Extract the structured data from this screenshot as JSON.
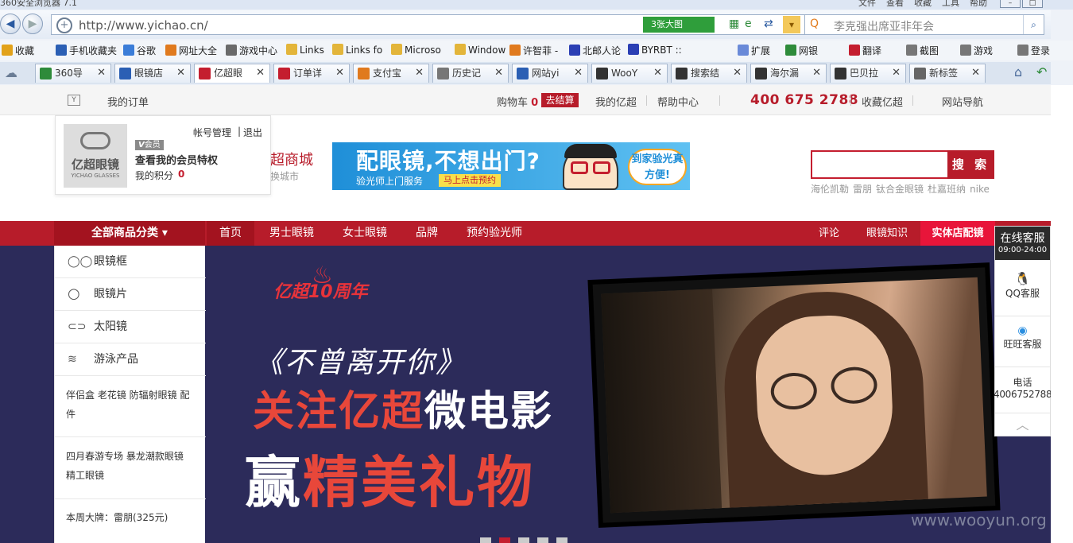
{
  "browser": {
    "title": "360安全浏览器 7.1",
    "menu": [
      "文件",
      "查看",
      "收藏",
      "工具",
      "帮助"
    ],
    "url": "http://www.yichao.cn/",
    "big_image_btn": "3张大图",
    "search_placeholder": "李克强出席亚非年会",
    "favorites": [
      {
        "label": "收藏",
        "icon": "star-icon"
      },
      {
        "label": "手机收藏夹",
        "icon": "phone-icon"
      },
      {
        "label": "谷歌",
        "icon": "google-icon"
      },
      {
        "label": "网址大全",
        "icon": "globe-icon"
      },
      {
        "label": "游戏中心",
        "icon": "gamepad-icon"
      },
      {
        "label": "Links",
        "icon": "folder-icon"
      },
      {
        "label": "Links fo",
        "icon": "folder-icon"
      },
      {
        "label": "Microso",
        "icon": "folder-icon"
      },
      {
        "label": "Window",
        "icon": "folder-icon"
      },
      {
        "label": "许智菲 -",
        "icon": "home-icon"
      },
      {
        "label": "北邮人论",
        "icon": "byr-icon"
      },
      {
        "label": "BYRBT ::",
        "icon": "byr-icon"
      },
      {
        "label": "扩展",
        "icon": "grid-icon"
      },
      {
        "label": "网银",
        "icon": "shield-icon"
      },
      {
        "label": "翻译",
        "icon": "translate-icon"
      },
      {
        "label": "截图",
        "icon": "scissors-icon"
      },
      {
        "label": "游戏",
        "icon": "gamepad-icon"
      },
      {
        "label": "登录",
        "icon": "user-icon"
      }
    ],
    "tabs": [
      {
        "label": "360导",
        "color": "#2e8b3a"
      },
      {
        "label": "眼镜店",
        "color": "#2b5fb4"
      },
      {
        "label": "亿超眼",
        "color": "#c41e2f"
      },
      {
        "label": "订单详",
        "color": "#c41e2f"
      },
      {
        "label": "支付宝",
        "color": "#e07a1e"
      },
      {
        "label": "历史记",
        "color": "#777777"
      },
      {
        "label": "网站yi",
        "color": "#2b5fb4"
      },
      {
        "label": "WooY",
        "color": "#333333"
      },
      {
        "label": "搜索结",
        "color": "#333333"
      },
      {
        "label": "海尔漏",
        "color": "#333333"
      },
      {
        "label": "巴贝拉",
        "color": "#333333"
      },
      {
        "label": "新标签",
        "color": "#666666"
      }
    ]
  },
  "topbar": {
    "my_orders": "我的订单",
    "cart": "购物车",
    "cart_count": "0",
    "checkout": "去结算",
    "my_yichao": "我的亿超",
    "help": "帮助中心",
    "phone": "400 675 2788",
    "favorite": "收藏亿超",
    "site_nav": "网站导航"
  },
  "account_popup": {
    "account_manage": "帐号管理",
    "logout": "退出",
    "member_badge": "会员",
    "privileges": "查看我的会员特权",
    "points_label": "我的积分",
    "points": "0",
    "logo_cn": "亿超眼镜",
    "logo_en": "YICHAO GLASSES"
  },
  "header": {
    "mall": "超商城",
    "switch_city": "换城市",
    "ad_title": "配眼镜,不想出门?",
    "ad_sub": "验光师上门服务",
    "ad_btn": "马上点击预约",
    "ad_tag": "到家验光真方便!",
    "search_btn": "搜 索",
    "hotwords": [
      "海伦凯勒",
      "雷朋",
      "钛合金眼镜",
      "杜嘉班纳",
      "nike"
    ]
  },
  "nav": {
    "all_categories": "全部商品分类",
    "items": [
      "首页",
      "男士眼镜",
      "女士眼镜",
      "品牌",
      "预约验光师"
    ],
    "right": [
      "评论",
      "眼镜知识"
    ],
    "store": "实体店配镜"
  },
  "categories": [
    {
      "label": "眼镜框",
      "icon": "glasses-icon"
    },
    {
      "label": "眼镜片",
      "icon": "lens-icon"
    },
    {
      "label": "太阳镜",
      "icon": "sunglasses-icon"
    },
    {
      "label": "游泳产品",
      "icon": "wave-icon"
    }
  ],
  "category_links": {
    "row1": "伴侣盒 老花镜 防辐射眼镜 配件",
    "row2": "四月春游专场 暴龙潮款眼镜 精工眼镜",
    "brand": "本周大牌：雷朋(325元)"
  },
  "service": {
    "title": "在线客服",
    "hours": "09:00-24:00",
    "qq": "QQ客服",
    "wangwang": "旺旺客服",
    "phone_label": "电话",
    "phone": "4006752788"
  },
  "hero": {
    "anniversary": "亿超10周年",
    "line1": "《不曾离开你》",
    "line2_red": "关注亿超",
    "line2_white": "微电影",
    "line3_white": "赢",
    "line3_red": "精美礼物",
    "slide_count": 5,
    "active_slide": 2
  },
  "watermark": "www.wooyun.org"
}
